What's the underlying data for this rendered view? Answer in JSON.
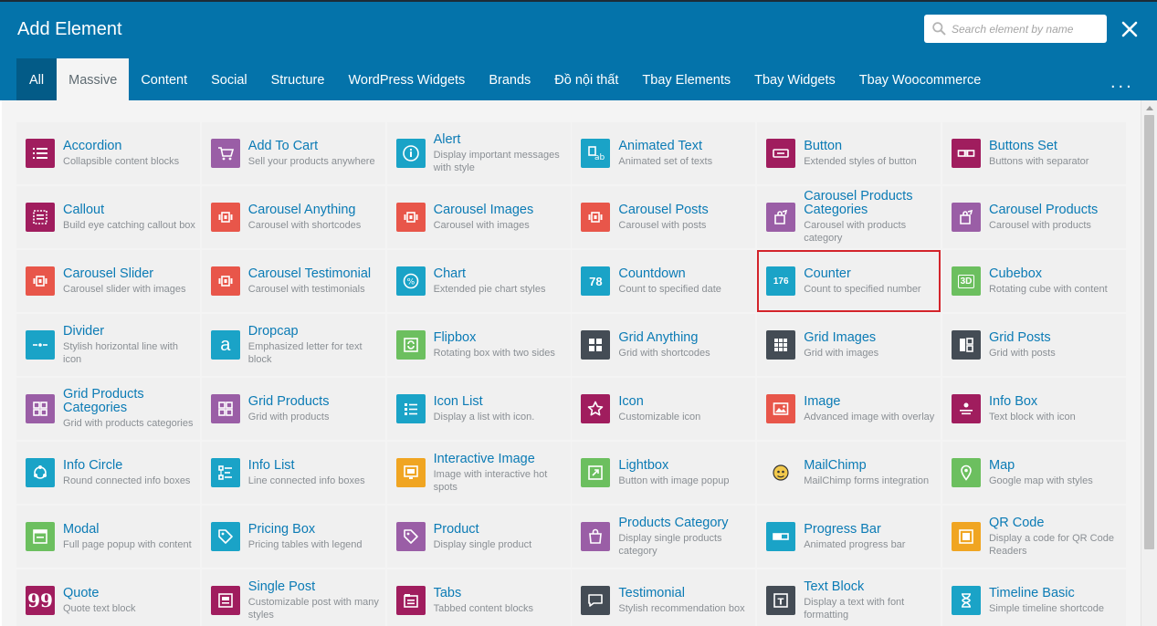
{
  "header": {
    "title": "Add Element"
  },
  "search": {
    "placeholder": "Search element by name",
    "value": ""
  },
  "tabs": [
    {
      "label": "All"
    },
    {
      "label": "Massive"
    },
    {
      "label": "Content"
    },
    {
      "label": "Social"
    },
    {
      "label": "Structure"
    },
    {
      "label": "WordPress Widgets"
    },
    {
      "label": "Brands"
    },
    {
      "label": "Đồ nội thất"
    },
    {
      "label": "Tbay Elements"
    },
    {
      "label": "Tbay Widgets"
    },
    {
      "label": "Tbay Woocommerce"
    }
  ],
  "active_tab": "Massive",
  "more_label": "...",
  "highlighted_element": "Counter",
  "colors": {
    "header": "#0473aa",
    "all_tab": "#035b87",
    "name_text": "#0b7bb5",
    "highlight": "#d3242b"
  },
  "elements": [
    {
      "name": "Accordion",
      "desc": "Collapsible content blocks",
      "icon": "list-icon",
      "color": "#a01d5e"
    },
    {
      "name": "Add To Cart",
      "desc": "Sell your products anywhere",
      "icon": "cart-icon",
      "color": "#9a5ea6"
    },
    {
      "name": "Alert",
      "desc": "Display important messages with style",
      "icon": "info-circle-icon",
      "color": "#1aa3c7"
    },
    {
      "name": "Animated Text",
      "desc": "Animated set of texts",
      "icon": "animated-text-icon",
      "color": "#1aa3c7"
    },
    {
      "name": "Button",
      "desc": "Extended styles of button",
      "icon": "button-icon",
      "color": "#a01d5e"
    },
    {
      "name": "Buttons Set",
      "desc": "Buttons with separator",
      "icon": "buttons-set-icon",
      "color": "#a01d5e"
    },
    {
      "name": "Callout",
      "desc": "Build eye catching callout box",
      "icon": "callout-icon",
      "color": "#a01d5e"
    },
    {
      "name": "Carousel Anything",
      "desc": "Carousel with shortcodes",
      "icon": "carousel-icon",
      "color": "#e8564a"
    },
    {
      "name": "Carousel Images",
      "desc": "Carousel with images",
      "icon": "carousel-icon",
      "color": "#e8564a"
    },
    {
      "name": "Carousel Posts",
      "desc": "Carousel with posts",
      "icon": "carousel-icon",
      "color": "#e8564a"
    },
    {
      "name": "Carousel Products Categories",
      "desc": "Carousel with products category",
      "icon": "product-share-icon",
      "color": "#9a5ea6"
    },
    {
      "name": "Carousel Products",
      "desc": "Carousel with products",
      "icon": "product-share-icon",
      "color": "#9a5ea6"
    },
    {
      "name": "Carousel Slider",
      "desc": "Carousel slider with images",
      "icon": "carousel-icon",
      "color": "#e8564a"
    },
    {
      "name": "Carousel Testimonial",
      "desc": "Carousel with testimonials",
      "icon": "carousel-icon",
      "color": "#e8564a"
    },
    {
      "name": "Chart",
      "desc": "Extended pie chart styles",
      "icon": "chart-icon",
      "color": "#1aa3c7"
    },
    {
      "name": "Countdown",
      "desc": "Count to specified date",
      "icon": "countdown-icon",
      "color": "#1aa3c7",
      "icon_text": "78"
    },
    {
      "name": "Counter",
      "desc": "Count to specified number",
      "icon": "counter-icon",
      "color": "#1aa3c7",
      "icon_text": "176"
    },
    {
      "name": "Cubebox",
      "desc": "Rotating cube with content",
      "icon": "cube-3d-icon",
      "color": "#6cbf5f",
      "icon_text": "3D"
    },
    {
      "name": "Divider",
      "desc": "Stylish horizontal line with icon",
      "icon": "divider-icon",
      "color": "#1aa3c7"
    },
    {
      "name": "Dropcap",
      "desc": "Emphasized letter for text block",
      "icon": "dropcap-icon",
      "color": "#1aa3c7",
      "icon_text": "a"
    },
    {
      "name": "Flipbox",
      "desc": "Rotating box with two sides",
      "icon": "flipbox-icon",
      "color": "#6cbf5f"
    },
    {
      "name": "Grid Anything",
      "desc": "Grid with shortcodes",
      "icon": "grid-4-icon",
      "color": "#444c55"
    },
    {
      "name": "Grid Images",
      "desc": "Grid with images",
      "icon": "grid-9-icon",
      "color": "#444c55"
    },
    {
      "name": "Grid Posts",
      "desc": "Grid with posts",
      "icon": "grid-posts-icon",
      "color": "#444c55"
    },
    {
      "name": "Grid Products Categories",
      "desc": "Grid with products categories",
      "icon": "grid-products-icon",
      "color": "#9a5ea6"
    },
    {
      "name": "Grid Products",
      "desc": "Grid with products",
      "icon": "grid-products-icon",
      "color": "#9a5ea6"
    },
    {
      "name": "Icon List",
      "desc": "Display a list with icon.",
      "icon": "icon-list-icon",
      "color": "#1aa3c7"
    },
    {
      "name": "Icon",
      "desc": "Customizable icon",
      "icon": "star-icon",
      "color": "#a01d5e"
    },
    {
      "name": "Image",
      "desc": "Advanced image with overlay",
      "icon": "image-icon",
      "color": "#e8564a"
    },
    {
      "name": "Info Box",
      "desc": "Text block with icon",
      "icon": "info-box-icon",
      "color": "#a01d5e"
    },
    {
      "name": "Info Circle",
      "desc": "Round connected info boxes",
      "icon": "info-circle-nodes-icon",
      "color": "#1aa3c7"
    },
    {
      "name": "Info List",
      "desc": "Line connected info boxes",
      "icon": "info-list-icon",
      "color": "#1aa3c7"
    },
    {
      "name": "Interactive Image",
      "desc": "Image with interactive hot spots",
      "icon": "interactive-image-icon",
      "color": "#f0a522"
    },
    {
      "name": "Lightbox",
      "desc": "Button with image popup",
      "icon": "lightbox-icon",
      "color": "#6cbf5f"
    },
    {
      "name": "MailChimp",
      "desc": "MailChimp forms integration",
      "icon": "mailchimp-icon",
      "color": "#f0f0f0"
    },
    {
      "name": "Map",
      "desc": "Google map with styles",
      "icon": "map-pin-icon",
      "color": "#6cbf5f"
    },
    {
      "name": "Modal",
      "desc": "Full page popup with content",
      "icon": "modal-icon",
      "color": "#6cbf5f"
    },
    {
      "name": "Pricing Box",
      "desc": "Pricing tables with legend",
      "icon": "price-tag-icon",
      "color": "#1aa3c7"
    },
    {
      "name": "Product",
      "desc": "Display single product",
      "icon": "tag-icon",
      "color": "#9a5ea6"
    },
    {
      "name": "Products Category",
      "desc": "Display single products category",
      "icon": "bag-icon",
      "color": "#9a5ea6"
    },
    {
      "name": "Progress Bar",
      "desc": "Animated progress bar",
      "icon": "progress-bar-icon",
      "color": "#1aa3c7"
    },
    {
      "name": "QR Code",
      "desc": "Display a code for QR Code Readers",
      "icon": "qr-code-icon",
      "color": "#f0a522"
    },
    {
      "name": "Quote",
      "desc": "Quote text block",
      "icon": "quote-icon",
      "color": "#a01d5e",
      "icon_text": "99"
    },
    {
      "name": "Single Post",
      "desc": "Customizable post with many styles",
      "icon": "single-post-icon",
      "color": "#a01d5e"
    },
    {
      "name": "Tabs",
      "desc": "Tabbed content blocks",
      "icon": "tabs-icon",
      "color": "#a01d5e"
    },
    {
      "name": "Testimonial",
      "desc": "Stylish recommendation box",
      "icon": "speech-bubble-icon",
      "color": "#444c55"
    },
    {
      "name": "Text Block",
      "desc": "Display a text with font formatting",
      "icon": "text-block-icon",
      "color": "#444c55"
    },
    {
      "name": "Timeline Basic",
      "desc": "Simple timeline shortcode",
      "icon": "hourglass-icon",
      "color": "#1aa3c7"
    }
  ]
}
